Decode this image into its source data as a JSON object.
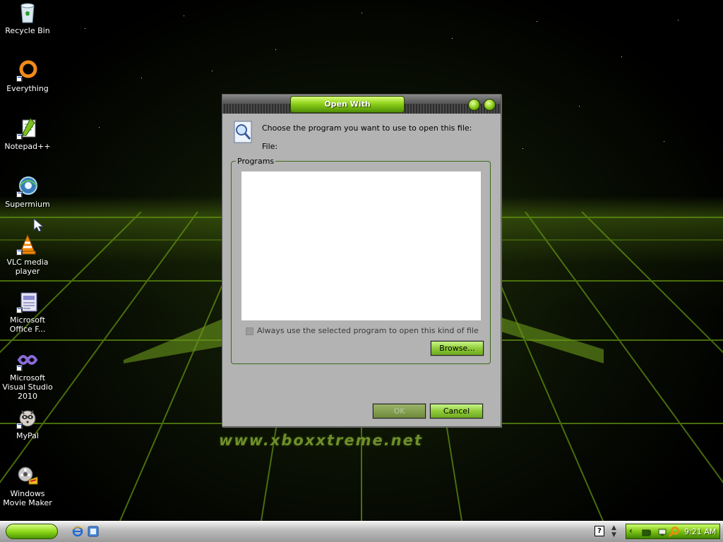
{
  "desktop": {
    "wallpaper_text": "www.xboxxtreme.net",
    "icons": [
      {
        "label": "Recycle Bin"
      },
      {
        "label": "Everything"
      },
      {
        "label": "Notepad++"
      },
      {
        "label": "Supermium"
      },
      {
        "label": "VLC media player"
      },
      {
        "label": "Microsoft Office F..."
      },
      {
        "label": "Microsoft Visual Studio 2010"
      },
      {
        "label": "MyPal"
      },
      {
        "label": "Windows Movie Maker"
      }
    ]
  },
  "dialog": {
    "title": "Open With",
    "prompt": "Choose the program you want to use to open this file:",
    "file_label": "File:",
    "programs_group_label": "Programs",
    "always_use_label": "Always use the selected program to open this kind of file",
    "always_use_checked": false,
    "browse_label": "Browse...",
    "ok_label": "OK",
    "cancel_label": "Cancel"
  },
  "taskbar": {
    "clock": "9:21 AM",
    "help_icon_label": "?"
  },
  "colors": {
    "accent_green": "#8fd21a",
    "dialog_gray": "#b3b3b3"
  }
}
